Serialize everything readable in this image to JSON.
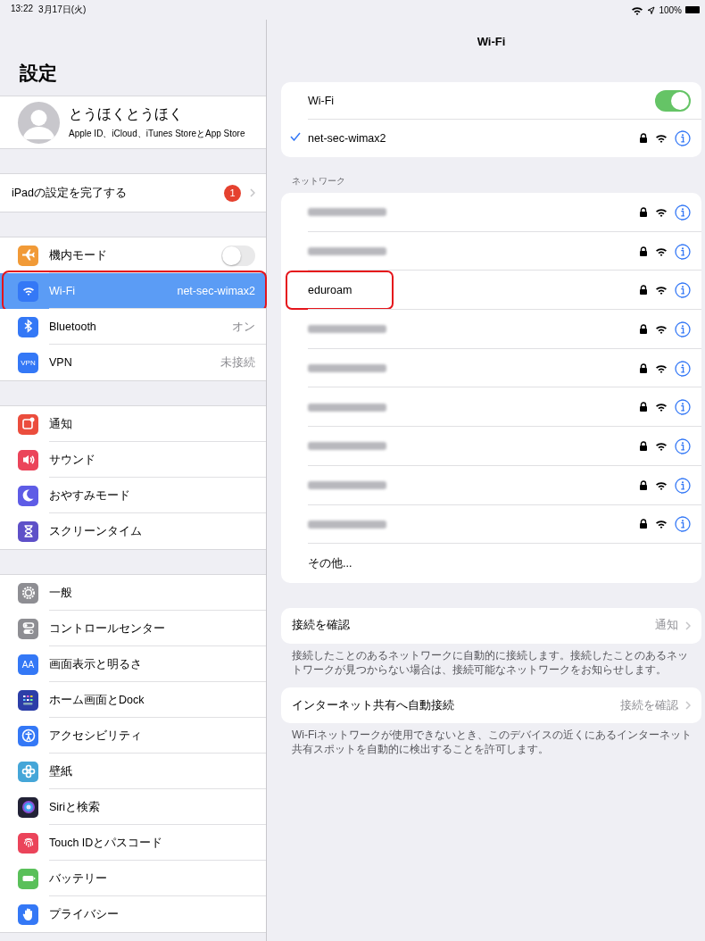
{
  "status_bar": {
    "time": "13:22",
    "date": "3月17日(火)",
    "battery": "100%"
  },
  "sidebar": {
    "title": "設定",
    "profile": {
      "name": "とうほくとうほく",
      "subtitle": "Apple ID、iCloud、iTunes StoreとApp Store"
    },
    "setup": {
      "label": "iPadの設定を完了する",
      "badge": "1"
    },
    "groups": [
      {
        "items": [
          {
            "kind": "toggle",
            "label": "機内モード",
            "on": false,
            "color": "#f19a37",
            "selected": false,
            "highlighted": false
          },
          {
            "kind": "detail",
            "label": "Wi-Fi",
            "value": "net-sec-wimax2",
            "color": "#3478f6",
            "selected": true,
            "highlighted": true
          },
          {
            "kind": "detail",
            "label": "Bluetooth",
            "value": "オン",
            "color": "#3478f6",
            "selected": false,
            "highlighted": false
          },
          {
            "kind": "detail",
            "label": "VPN",
            "value": "未接続",
            "icon_text": "VPN",
            "color": "#3478f6",
            "selected": false,
            "highlighted": false
          }
        ]
      },
      {
        "items": [
          {
            "kind": "plain",
            "label": "通知",
            "color": "#eb4d3d",
            "selected": false,
            "highlighted": false
          },
          {
            "kind": "plain",
            "label": "サウンド",
            "color": "#eb445a",
            "selected": false,
            "highlighted": false
          },
          {
            "kind": "plain",
            "label": "おやすみモード",
            "color": "#5e5ce6",
            "selected": false,
            "highlighted": false
          },
          {
            "kind": "plain",
            "label": "スクリーンタイム",
            "color": "#5e50c8",
            "selected": false,
            "highlighted": false
          }
        ]
      },
      {
        "items": [
          {
            "kind": "plain",
            "label": "一般",
            "color": "#8e8e93",
            "selected": false,
            "highlighted": false
          },
          {
            "kind": "plain",
            "label": "コントロールセンター",
            "color": "#8e8e93",
            "selected": false,
            "highlighted": false
          },
          {
            "kind": "plain",
            "label": "画面表示と明るさ",
            "icon_text": "AA",
            "color": "#3478f6",
            "selected": false,
            "highlighted": false
          },
          {
            "kind": "plain",
            "label": "ホーム画面とDock",
            "color": "#2c3ea8",
            "selected": false,
            "highlighted": false
          },
          {
            "kind": "plain",
            "label": "アクセシビリティ",
            "color": "#3478f6",
            "selected": false,
            "highlighted": false
          },
          {
            "kind": "plain",
            "label": "壁紙",
            "color": "#45a6d8",
            "selected": false,
            "highlighted": false
          },
          {
            "kind": "plain",
            "label": "Siriと検索",
            "color": "#222236",
            "selected": false,
            "highlighted": false
          },
          {
            "kind": "plain",
            "label": "Touch IDとパスコード",
            "color": "#eb445a",
            "selected": false,
            "highlighted": false
          },
          {
            "kind": "plain",
            "label": "バッテリー",
            "color": "#5ac05a",
            "selected": false,
            "highlighted": false
          },
          {
            "kind": "plain",
            "label": "プライバシー",
            "color": "#3478f6",
            "selected": false,
            "highlighted": false
          }
        ]
      }
    ]
  },
  "wifi_pane": {
    "title": "Wi-Fi",
    "wifi_toggle": {
      "label": "Wi-Fi",
      "on": true
    },
    "current_network": {
      "name": "net-sec-wimax2",
      "checked": true
    },
    "networks_header": "ネットワーク",
    "networks": [
      {
        "kind": "redacted",
        "highlighted": false
      },
      {
        "kind": "redacted",
        "highlighted": false
      },
      {
        "kind": "named",
        "name": "eduroam",
        "highlighted": true
      },
      {
        "kind": "redacted",
        "highlighted": false
      },
      {
        "kind": "redacted",
        "highlighted": false
      },
      {
        "kind": "redacted",
        "highlighted": false
      },
      {
        "kind": "redacted",
        "highlighted": false
      },
      {
        "kind": "redacted",
        "highlighted": false
      },
      {
        "kind": "redacted",
        "highlighted": false
      }
    ],
    "other": "その他...",
    "settings": [
      {
        "label": "接続を確認",
        "value": "通知",
        "footnote": "接続したことのあるネットワークに自動的に接続します。接続したことのあるネットワークが見つからない場合は、接続可能なネットワークをお知らせします。"
      },
      {
        "label": "インターネット共有へ自動接続",
        "value": "接続を確認",
        "footnote": "Wi-Fiネットワークが使用できないとき、このデバイスの近くにあるインターネット共有スポットを自動的に検出することを許可します。"
      }
    ]
  }
}
